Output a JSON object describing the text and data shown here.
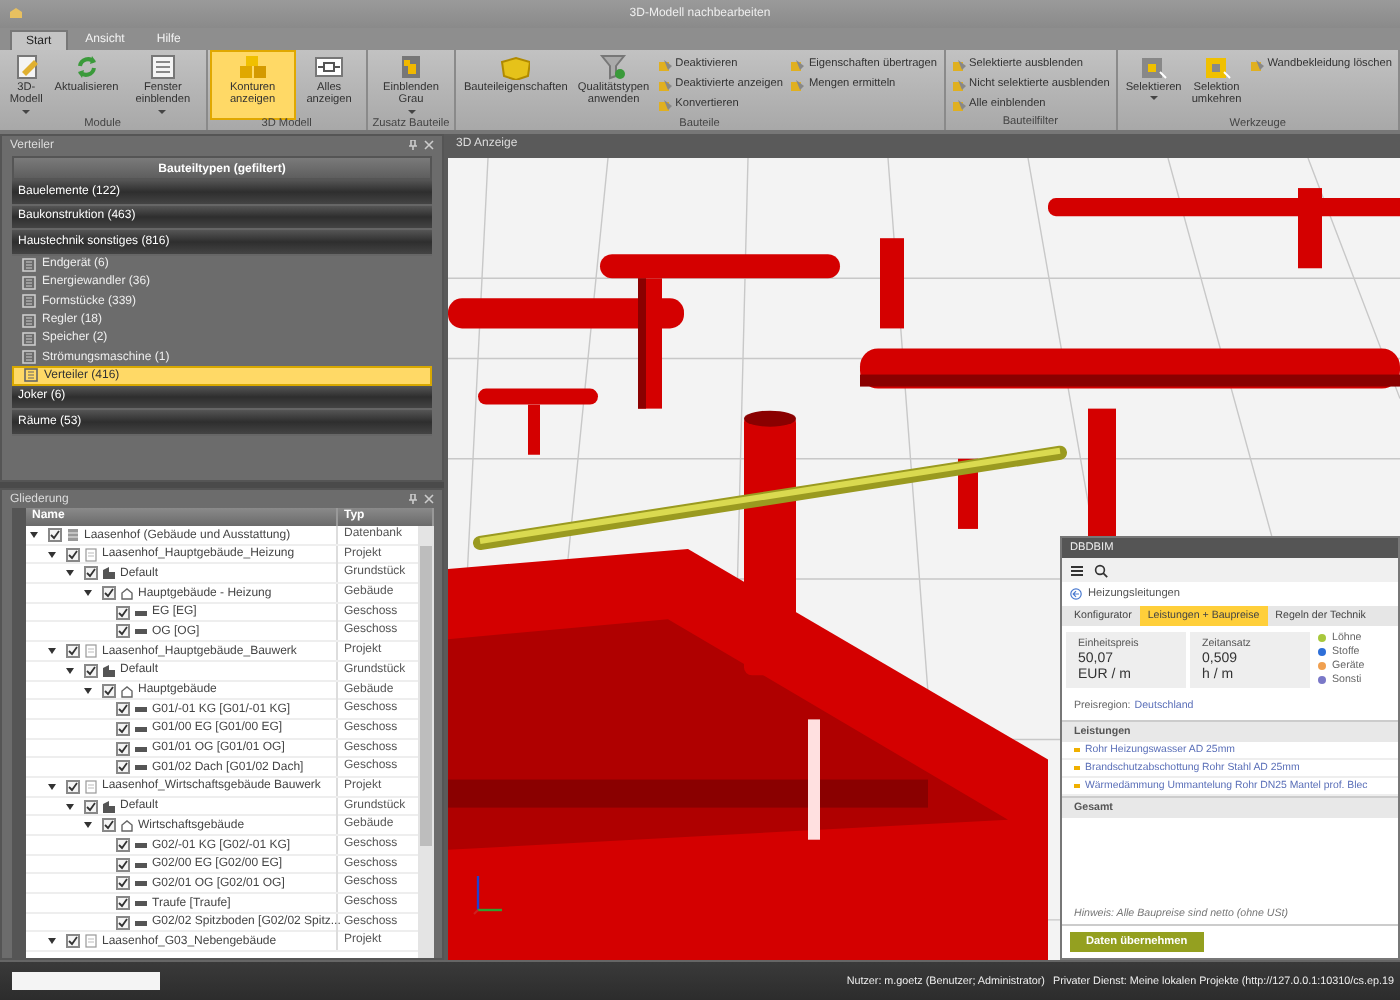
{
  "window": {
    "title": "3D-Modell nachbearbeiten"
  },
  "ribbon": {
    "tabs": [
      {
        "label": "Start",
        "selected": true
      },
      {
        "label": "Ansicht",
        "selected": false
      },
      {
        "label": "Hilfe",
        "selected": false
      }
    ],
    "groups": [
      {
        "label": "Module",
        "items": [
          {
            "kind": "large",
            "label": "3D-Modell",
            "dropdown": true,
            "selected": false
          },
          {
            "kind": "large",
            "label": "Aktualisieren",
            "dropdown": false,
            "selected": false
          },
          {
            "kind": "large",
            "label": "Fenster einblenden",
            "dropdown": true,
            "selected": false
          }
        ]
      },
      {
        "label": "3D Modell",
        "items": [
          {
            "kind": "large",
            "label": "Konturen anzeigen",
            "dropdown": false,
            "selected": true
          },
          {
            "kind": "large",
            "label": "Alles anzeigen",
            "dropdown": false,
            "selected": false
          }
        ]
      },
      {
        "label": "Zusatz Bauteile",
        "items": [
          {
            "kind": "large",
            "label": "Einblenden Grau",
            "dropdown": true,
            "selected": false
          }
        ]
      },
      {
        "label": "Bauteile",
        "items": [
          {
            "kind": "large",
            "label": "Bauteileigenschaften",
            "dropdown": false,
            "selected": false
          },
          {
            "kind": "large",
            "label": "Qualitätstypen anwenden",
            "dropdown": false,
            "selected": false
          },
          {
            "kind": "small",
            "label": "Deaktivieren",
            "selected": false
          },
          {
            "kind": "small",
            "label": "Deaktivierte anzeigen",
            "selected": false
          },
          {
            "kind": "small",
            "label": "Konvertieren",
            "selected": false
          },
          {
            "kind": "small",
            "label": "Eigenschaften übertragen",
            "selected": false
          },
          {
            "kind": "small",
            "label": "Mengen ermitteln",
            "selected": false
          }
        ]
      },
      {
        "label": "Bauteilfilter",
        "items": [
          {
            "kind": "small",
            "label": "Selektierte ausblenden",
            "selected": false
          },
          {
            "kind": "small",
            "label": "Nicht selektierte ausblenden",
            "selected": false
          },
          {
            "kind": "small",
            "label": "Alle einblenden",
            "selected": false
          }
        ]
      },
      {
        "label": "Werkzeuge",
        "items": [
          {
            "kind": "large",
            "label": "Selektieren",
            "dropdown": true,
            "selected": false
          },
          {
            "kind": "large",
            "label": "Selektion umkehren",
            "dropdown": false,
            "selected": false
          },
          {
            "kind": "small",
            "label": "Wandbekleidung löschen",
            "selected": false
          }
        ]
      }
    ]
  },
  "verteiler": {
    "title": "Verteiler",
    "heading": "Bauteiltypen (gefiltert)",
    "categories": [
      {
        "label": "Bauelemente (122)"
      },
      {
        "label": "Baukonstruktion (463)"
      },
      {
        "label": "Haustechnik sonstiges (816)",
        "children": [
          {
            "label": "Endgerät (6)",
            "selected": false
          },
          {
            "label": "Energiewandler (36)",
            "selected": false
          },
          {
            "label": "Formstücke (339)",
            "selected": false
          },
          {
            "label": "Regler (18)",
            "selected": false
          },
          {
            "label": "Speicher (2)",
            "selected": false
          },
          {
            "label": "Strömungsmaschine (1)",
            "selected": false
          },
          {
            "label": "Verteiler (416)",
            "selected": true
          }
        ]
      },
      {
        "label": "Joker (6)"
      },
      {
        "label": "Räume (53)"
      }
    ]
  },
  "gliederung": {
    "title": "Gliederung",
    "columns": [
      "Name",
      "Typ"
    ],
    "rows": [
      {
        "kind": "database",
        "name": "Laasenhof  (Gebäude und Ausstattung)",
        "type": "Datenbank",
        "checked": true,
        "expanded": true,
        "children": [
          {
            "kind": "project",
            "name": "Laasenhof_Hauptgebäude_Heizung",
            "type": "Projekt",
            "checked": true,
            "expanded": true,
            "children": [
              {
                "kind": "site",
                "name": "Default",
                "type": "Grundstück",
                "checked": true,
                "expanded": true,
                "children": [
                  {
                    "kind": "building",
                    "name": "Hauptgebäude - Heizung",
                    "type": "Gebäude",
                    "checked": true,
                    "expanded": true,
                    "children": [
                      {
                        "kind": "floor",
                        "name": "EG [EG]",
                        "type": "Geschoss",
                        "checked": true
                      },
                      {
                        "kind": "floor",
                        "name": "OG [OG]",
                        "type": "Geschoss",
                        "checked": true
                      }
                    ]
                  }
                ]
              }
            ]
          },
          {
            "kind": "project",
            "name": "Laasenhof_Hauptgebäude_Bauwerk",
            "type": "Projekt",
            "checked": true,
            "expanded": true,
            "children": [
              {
                "kind": "site",
                "name": "Default",
                "type": "Grundstück",
                "checked": true,
                "expanded": true,
                "children": [
                  {
                    "kind": "building",
                    "name": "Hauptgebäude",
                    "type": "Gebäude",
                    "checked": true,
                    "expanded": true,
                    "children": [
                      {
                        "kind": "floor",
                        "name": "G01/-01 KG [G01/-01 KG]",
                        "type": "Geschoss",
                        "checked": true
                      },
                      {
                        "kind": "floor",
                        "name": "G01/00 EG [G01/00 EG]",
                        "type": "Geschoss",
                        "checked": true
                      },
                      {
                        "kind": "floor",
                        "name": "G01/01 OG [G01/01 OG]",
                        "type": "Geschoss",
                        "checked": true
                      },
                      {
                        "kind": "floor",
                        "name": "G01/02 Dach [G01/02 Dach]",
                        "type": "Geschoss",
                        "checked": true
                      }
                    ]
                  }
                ]
              }
            ]
          },
          {
            "kind": "project",
            "name": "Laasenhof_Wirtschaftsgebäude Bauwerk",
            "type": "Projekt",
            "checked": true,
            "expanded": true,
            "children": [
              {
                "kind": "site",
                "name": "Default",
                "type": "Grundstück",
                "checked": true,
                "expanded": true,
                "children": [
                  {
                    "kind": "building",
                    "name": "Wirtschaftsgebäude",
                    "type": "Gebäude",
                    "checked": true,
                    "expanded": true,
                    "children": [
                      {
                        "kind": "floor",
                        "name": "G02/-01 KG [G02/-01 KG]",
                        "type": "Geschoss",
                        "checked": true
                      },
                      {
                        "kind": "floor",
                        "name": "G02/00 EG [G02/00 EG]",
                        "type": "Geschoss",
                        "checked": true
                      },
                      {
                        "kind": "floor",
                        "name": "G02/01 OG [G02/01 OG]",
                        "type": "Geschoss",
                        "checked": true
                      },
                      {
                        "kind": "floor",
                        "name": "Traufe [Traufe]",
                        "type": "Geschoss",
                        "checked": true
                      },
                      {
                        "kind": "floor",
                        "name": "G02/02 Spitzboden [G02/02 Spitz...",
                        "type": "Geschoss",
                        "checked": true
                      }
                    ]
                  }
                ]
              }
            ]
          },
          {
            "kind": "project",
            "name": "Laasenhof_G03_Nebengebäude",
            "type": "Projekt",
            "checked": true,
            "expanded": true
          }
        ]
      }
    ]
  },
  "viewport": {
    "title": "3D Anzeige"
  },
  "dbdbim": {
    "title": "DBDBIM",
    "back": "Heizungsleitungen",
    "tabs": [
      {
        "label": "Konfigurator",
        "selected": false
      },
      {
        "label": "Leistungen + Baupreise",
        "selected": true
      },
      {
        "label": "Regeln der Technik",
        "selected": false
      }
    ],
    "cards": [
      {
        "label": "Einheitspreis",
        "value": "50,07",
        "unit": "EUR / m"
      },
      {
        "label": "Zeitansatz",
        "value": "0,509",
        "unit": "h / m"
      }
    ],
    "legend": [
      {
        "label": "Löhne",
        "color": "#a8c83c"
      },
      {
        "label": "Stoffe",
        "color": "#2e6fd8"
      },
      {
        "label": "Geräte",
        "color": "#f0a050"
      },
      {
        "label": "Sonsti",
        "color": "#7a78c8"
      }
    ],
    "region_label": "Preisregion:",
    "region": "Deutschland",
    "sections": [
      {
        "title": "Leistungen",
        "items": [
          "Rohr Heizungswasser AD 25mm",
          "Brandschutzabschottung Rohr Stahl AD 25mm",
          "Wärmedämmung Ummantelung Rohr DN25 Mantel prof. Blec"
        ]
      },
      {
        "title": "Gesamt"
      }
    ],
    "note": "Hinweis: Alle Baupreise sind netto (ohne USt)",
    "button": "Daten übernehmen"
  },
  "status_bar": {
    "user": "Nutzer: m.goetz (Benutzer; Administrator)",
    "service": "Privater Dienst: Meine lokalen Projekte (http://127.0.0.1:10310/cs.ep.19"
  }
}
